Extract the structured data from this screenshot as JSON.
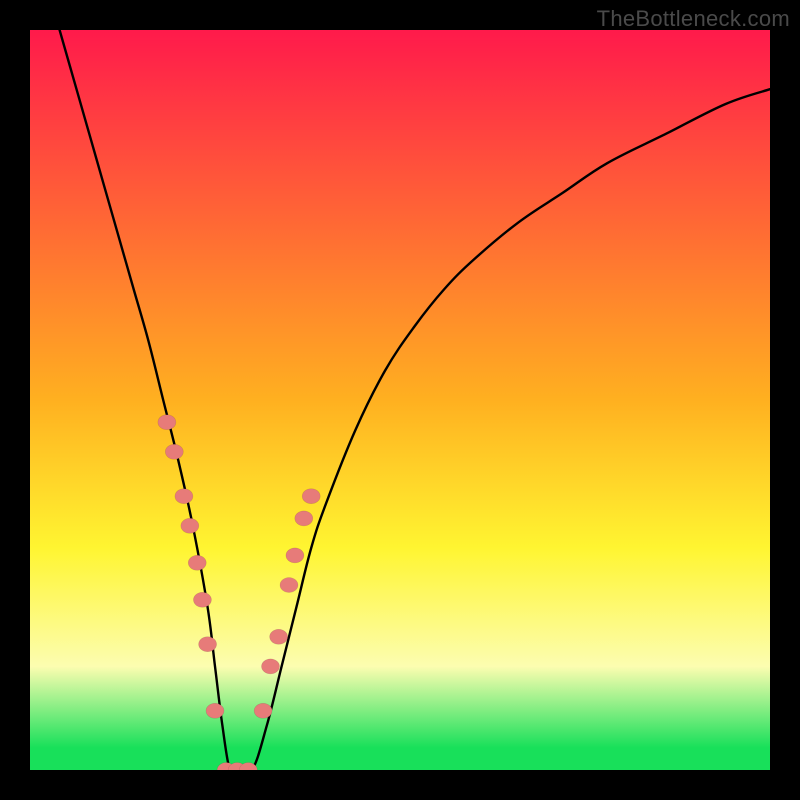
{
  "watermark": {
    "text": "TheBottleneck.com"
  },
  "colors": {
    "top_red": "#ff1a4b",
    "mid_orange": "#ffb020",
    "yellow": "#fff531",
    "pale_yellow": "#fcfdb0",
    "green": "#18e05a",
    "black": "#000000",
    "bead": "#e77b79"
  },
  "chart_data": {
    "type": "line",
    "title": "",
    "xlabel": "",
    "ylabel": "",
    "xlim": [
      0,
      100
    ],
    "ylim": [
      0,
      100
    ],
    "grid": false,
    "legend": "none",
    "series": [
      {
        "name": "curve",
        "x": [
          4,
          6,
          8,
          10,
          12,
          14,
          16,
          18,
          20,
          22,
          24,
          25,
          26,
          27,
          28,
          30,
          32,
          34,
          36,
          38,
          40,
          44,
          48,
          52,
          56,
          60,
          66,
          72,
          78,
          86,
          94,
          100
        ],
        "y": [
          100,
          93,
          86,
          79,
          72,
          65,
          58,
          50,
          42,
          33,
          22,
          14,
          6,
          0,
          0,
          0,
          6,
          14,
          22,
          30,
          36,
          46,
          54,
          60,
          65,
          69,
          74,
          78,
          82,
          86,
          90,
          92
        ]
      },
      {
        "name": "bead-markers",
        "x": [
          18.5,
          19.5,
          20.8,
          21.6,
          22.6,
          23.3,
          24.0,
          25.0,
          26.5,
          28.0,
          29.5,
          31.5,
          32.5,
          33.6,
          35.0,
          35.8,
          37.0,
          38.0
        ],
        "y": [
          47,
          43,
          37,
          33,
          28,
          23,
          17,
          8,
          0,
          0,
          0,
          8,
          14,
          18,
          25,
          29,
          34,
          37
        ]
      }
    ],
    "gradient_stops_pct_from_top": [
      {
        "pct": 0,
        "color": "#ff1a4b"
      },
      {
        "pct": 50,
        "color": "#ffb020"
      },
      {
        "pct": 70,
        "color": "#fff531"
      },
      {
        "pct": 86,
        "color": "#fcfdb0"
      },
      {
        "pct": 97,
        "color": "#18e05a"
      },
      {
        "pct": 100,
        "color": "#18e05a"
      }
    ],
    "notch_x_pct": 27
  }
}
